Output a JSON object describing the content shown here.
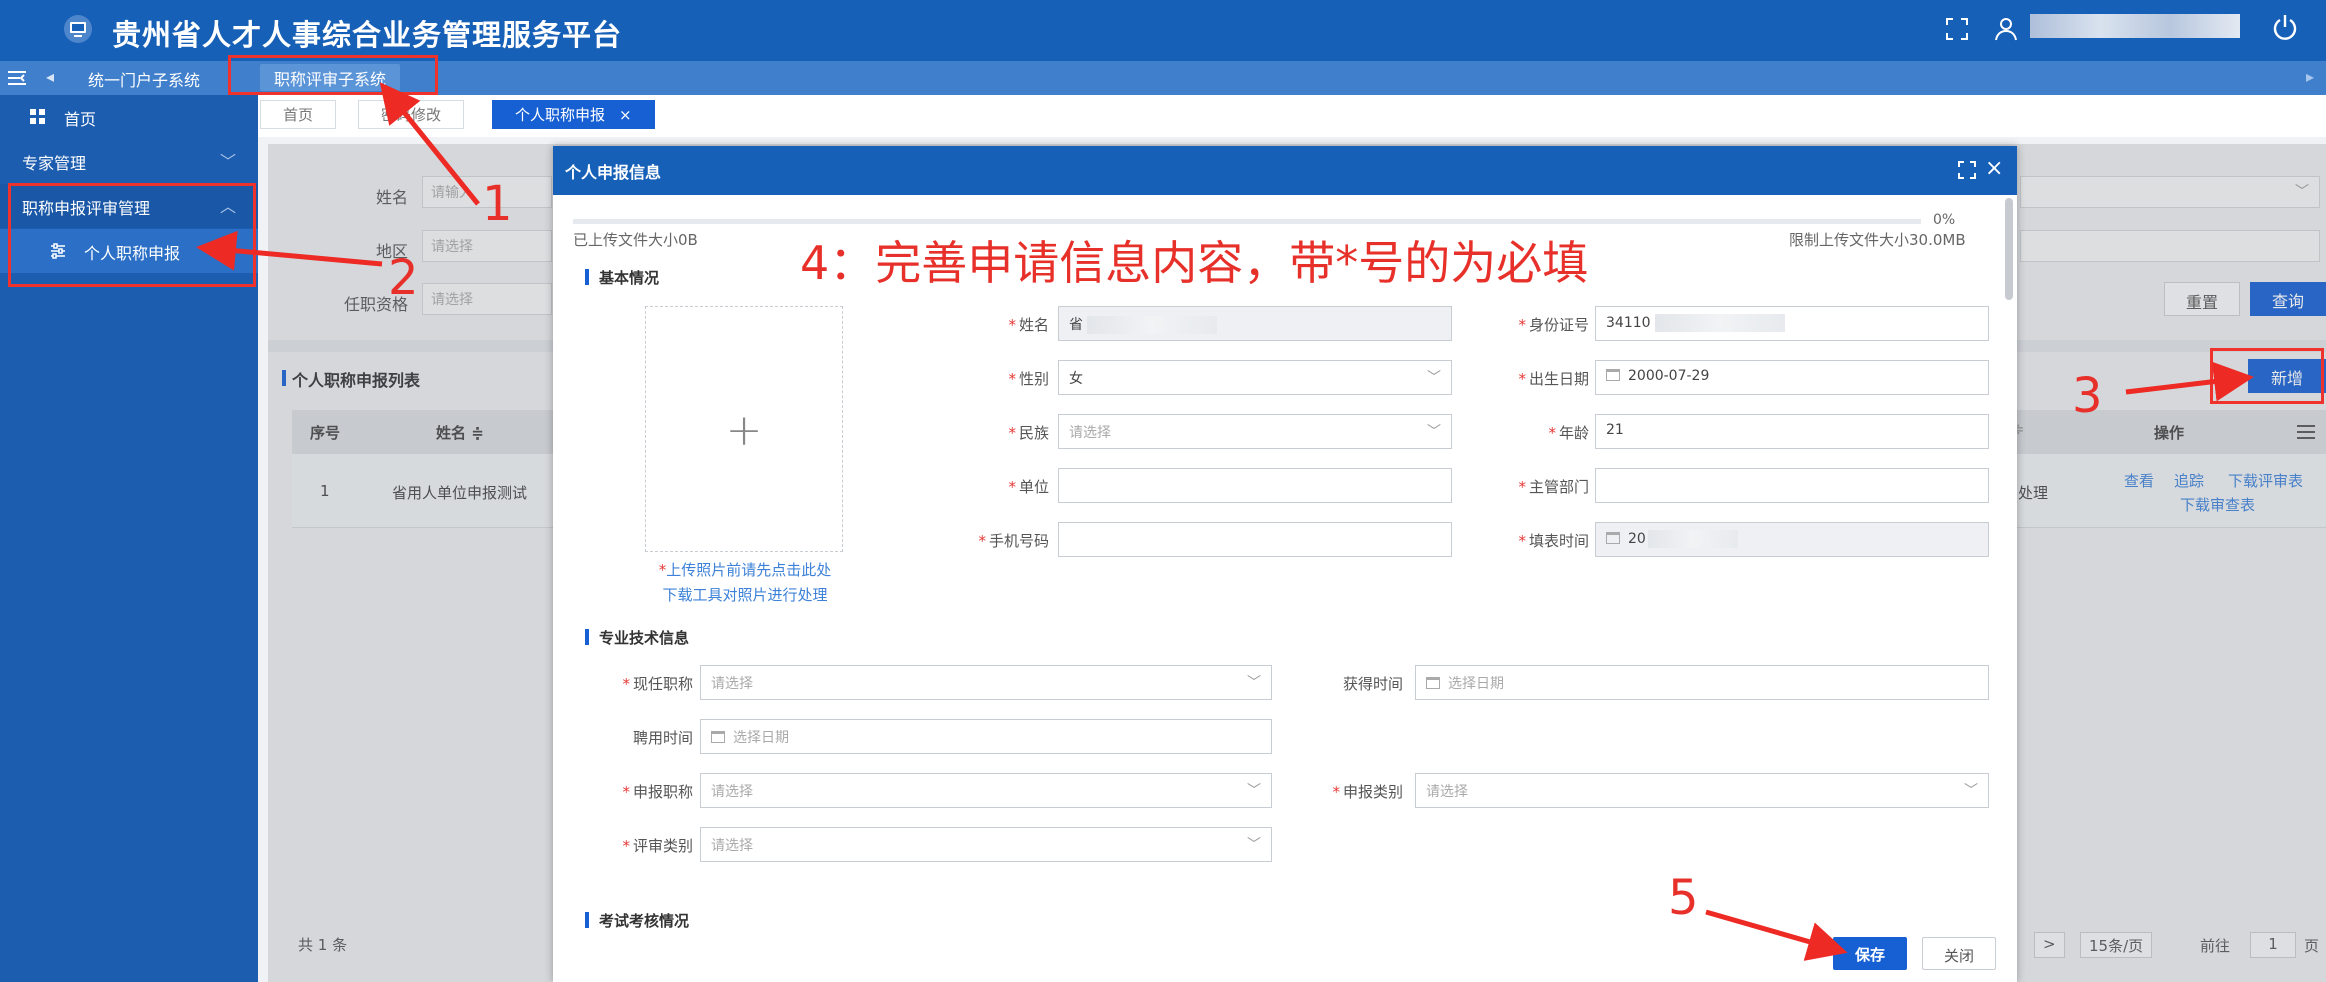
{
  "header": {
    "title": "贵州省人才人事综合业务管理服务平台",
    "icons": [
      "monitor-icon",
      "fullscreen-icon",
      "user-icon",
      "power-icon"
    ]
  },
  "subnav": {
    "back": "◂",
    "system1": "统一门户子系统",
    "system2": "职称评审子系统",
    "more": "▸"
  },
  "sidebar": {
    "home": "首页",
    "expert": "专家管理",
    "title_mgmt": "职称申报评审管理",
    "personal": "个人职称申报",
    "chev_expand": "﹀",
    "chev_collapse": "︿"
  },
  "tabs": {
    "home": "首页",
    "pwd": "密码修改",
    "personal": "个人职称申报",
    "close": "×"
  },
  "filter": {
    "name_label": "姓名",
    "name_placeholder": "请输入",
    "region_label": "地区",
    "region_placeholder": "请选择",
    "qual_label": "任职资格",
    "qual_placeholder": "请选择",
    "reset": "重置",
    "query": "查询"
  },
  "list": {
    "title": "个人职称申报列表",
    "add": "新增",
    "headers": {
      "index": "序号",
      "name": "姓名 ≑",
      "ops": "操作"
    },
    "row": {
      "index": "1",
      "name": "省用人单位申报测试",
      "status": "处理",
      "ops": [
        "查看",
        "追踪",
        "下载评审表",
        "下载审查表"
      ]
    },
    "total": "共 1 条",
    "pager": {
      "next": ">",
      "size": "15条/页",
      "goto": "前往",
      "page": "1",
      "unit": "页"
    }
  },
  "modal": {
    "title": "个人申报信息",
    "progress_pct": "0%",
    "upload_size": "已上传文件大小0B",
    "upload_limit": "限制上传文件大小30.0MB",
    "section_basic": "基本情况",
    "photo_tip_req": "*",
    "photo_tip_1": "上传照片前请先点击此处",
    "photo_tip_2": "下载工具对照片进行处理",
    "req": "*",
    "fields": {
      "name_label": "姓名",
      "name_value": "省",
      "id_label": "身份证号",
      "id_value": "34110",
      "gender_label": "性别",
      "gender_value": "女",
      "birth_label": "出生日期",
      "birth_value": "2000-07-29",
      "ethnic_label": "民族",
      "ethnic_placeholder": "请选择",
      "age_label": "年龄",
      "age_value": "21",
      "unit_label": "单位",
      "dept_label": "主管部门",
      "phone_label": "手机号码",
      "fill_label": "填表时间",
      "fill_value": "20"
    },
    "section_tech": "专业技术信息",
    "tech": {
      "current_label": "现任职称",
      "current_placeholder": "请选择",
      "obtain_label": "获得时间",
      "obtain_placeholder": "选择日期",
      "hire_label": "聘用时间",
      "hire_placeholder": "选择日期",
      "apply_label": "申报职称",
      "apply_placeholder": "请选择",
      "category_label": "申报类别",
      "category_placeholder": "请选择",
      "review_label": "评审类别",
      "review_placeholder": "请选择"
    },
    "section_exam": "考试考核情况",
    "save": "保存",
    "close_btn": "关闭",
    "close_x": "×"
  },
  "annotations": {
    "n1": "1",
    "n2": "2",
    "n3": "3",
    "n5": "5",
    "step4": "4：完善申请信息内容，带*号的为必填",
    "color": "#e8302a"
  },
  "colors": {
    "primary": "#1760b7",
    "sidebar": "#1c5daf",
    "button": "#1760d3"
  }
}
